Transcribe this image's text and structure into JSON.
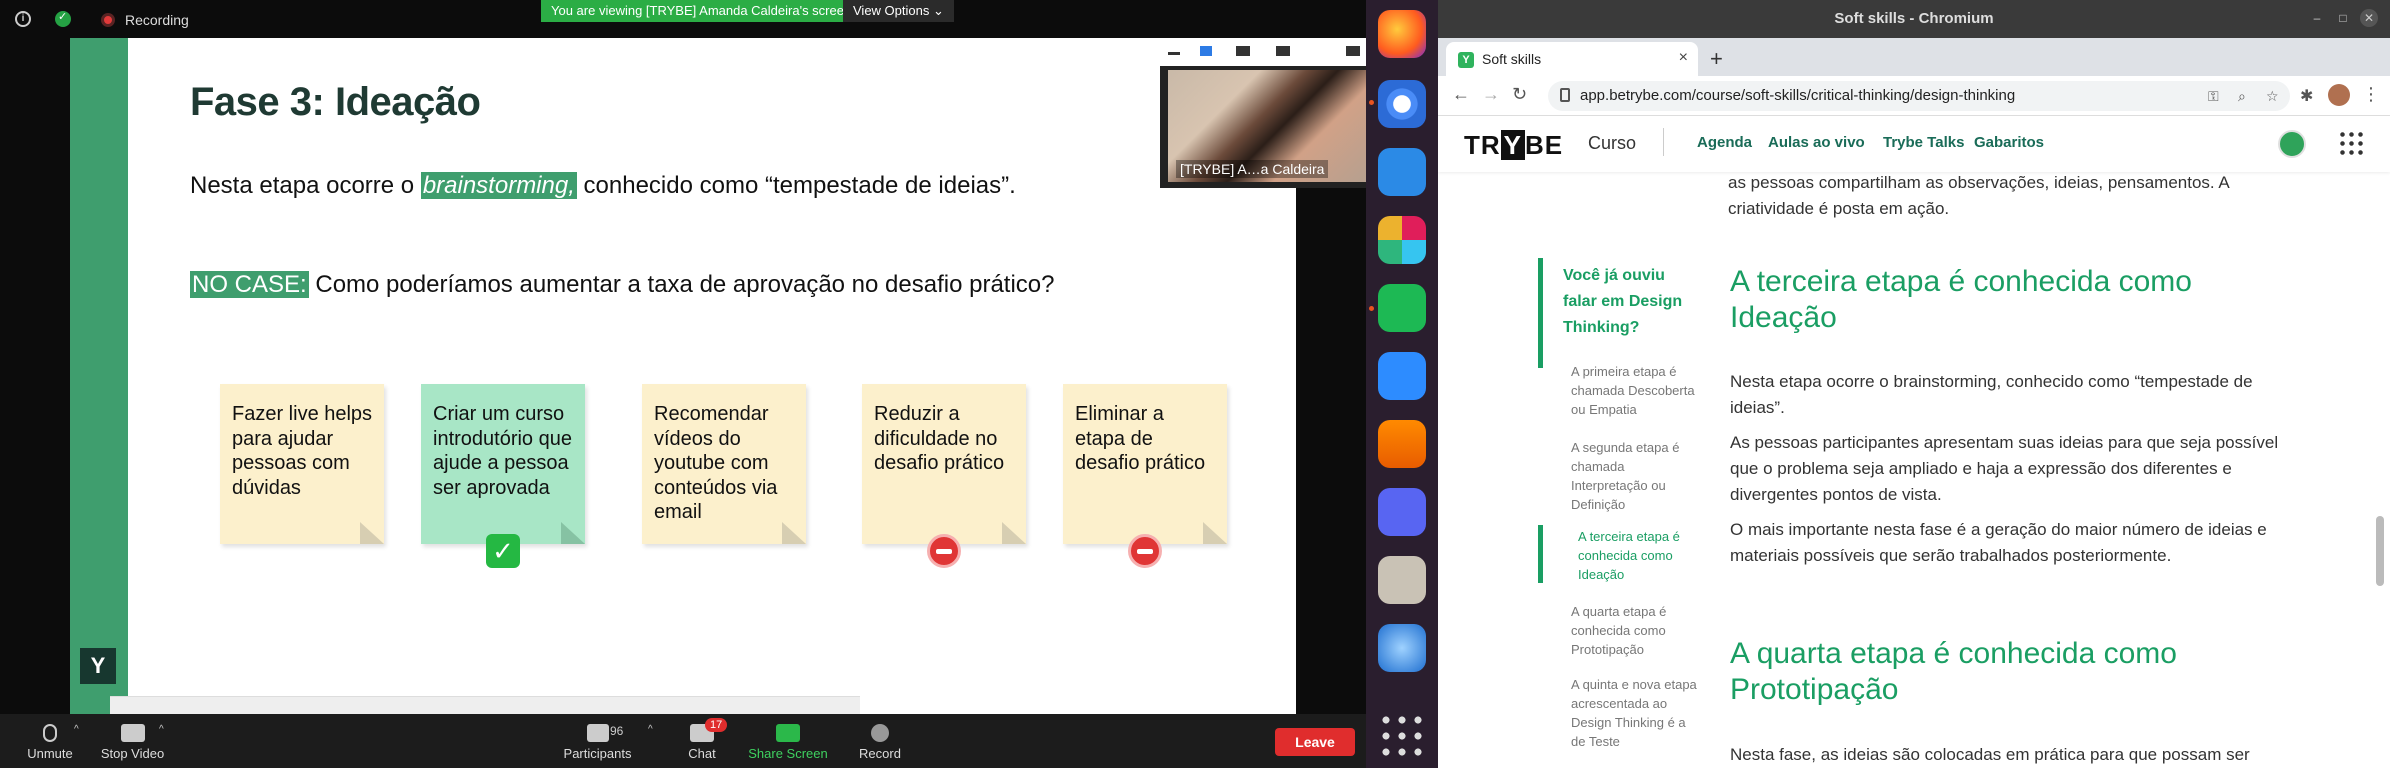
{
  "zoom": {
    "recording_label": "Recording",
    "viewing_banner": "You are viewing [TRYBE] Amanda Caldeira's screen",
    "view_options": "View Options",
    "thumbnail_name": "[TRYBE] A…a Caldeira",
    "bottom": {
      "unmute": "Unmute",
      "stop_video": "Stop Video",
      "participants": "Participants",
      "participants_count": "96",
      "chat": "Chat",
      "chat_badge": "17",
      "share_screen": "Share Screen",
      "record": "Record",
      "leave": "Leave"
    }
  },
  "slide": {
    "title": "Fase 3: Ideação",
    "line1_pre": "Nesta etapa ocorre o ",
    "line1_highlight": "brainstorming,",
    "line1_post": " conhecido como “tempestade de ideias”.",
    "line2_highlight": "NO CASE:",
    "line2_post": " Como poderíamos aumentar a taxa de aprovação no desafio prático?",
    "logo": "Y",
    "notes": [
      {
        "text": "Fazer live helps para ajudar pessoas com dúvidas",
        "badge": ""
      },
      {
        "text": "Criar um curso introdutório que ajude a pessoa ser aprovada",
        "badge": "check"
      },
      {
        "text": "Recomendar vídeos do youtube com conteúdos via email",
        "badge": ""
      },
      {
        "text": "Reduzir a dificuldade no desafio prático",
        "badge": "no-entry"
      },
      {
        "text": "Eliminar a etapa de desafio prático",
        "badge": "no-entry"
      }
    ]
  },
  "dock": {
    "apps": [
      "firefox-icon",
      "chromium-icon",
      "vscode-icon",
      "slack-icon",
      "simplenote-icon",
      "zoom-icon",
      "vlc-icon",
      "discord-icon",
      "files-icon",
      "thunderbird-icon",
      "show-apps-icon"
    ]
  },
  "chrome": {
    "window_title": "Soft skills - Chromium",
    "tab_title": "Soft skills",
    "url": "app.betrybe.com/course/soft-skills/critical-thinking/design-thinking"
  },
  "site": {
    "logo": "TRYBE",
    "curso": "Curso",
    "nav": [
      "Agenda",
      "Aulas ao vivo",
      "Trybe Talks",
      "Gabaritos"
    ],
    "top_fragment": "as pessoas compartilham as observações, ideias, pensamentos. A criatividade é posta em ação.",
    "toc_title": "Você já ouviu falar em Design Thinking?",
    "toc_items": [
      "A primeira etapa é chamada Descoberta ou Empatia",
      "A segunda etapa é chamada Interpretação ou Definição",
      "A terceira etapa é conhecida como Ideação",
      "A quarta etapa é conhecida como Prototipação",
      "A quinta e nova etapa acrescentada ao Design Thinking é a de Teste"
    ],
    "h2_ideacao": "A terceira etapa é conhecida como Ideação",
    "p1": "Nesta etapa ocorre o brainstorming, conhecido como “tempestade de ideias”.",
    "p2": "As pessoas participantes apresentam suas ideias para que seja possível que o problema seja ampliado e haja a expressão dos diferentes e divergentes pontos de vista.",
    "p3": "O mais importante nesta fase é a geração do maior número de ideias e materiais possíveis que serão trabalhados posteriormente.",
    "h2_prototipacao": "A quarta etapa é conhecida como Prototipação",
    "p4": "Nesta fase, as ideias são colocadas em prática para que possam ser"
  },
  "colors": {
    "trybe_green": "#1a9e63",
    "slide_green": "#3f9e6e",
    "zoom_banner": "#2bad45",
    "leave_red": "#e02d2d"
  }
}
